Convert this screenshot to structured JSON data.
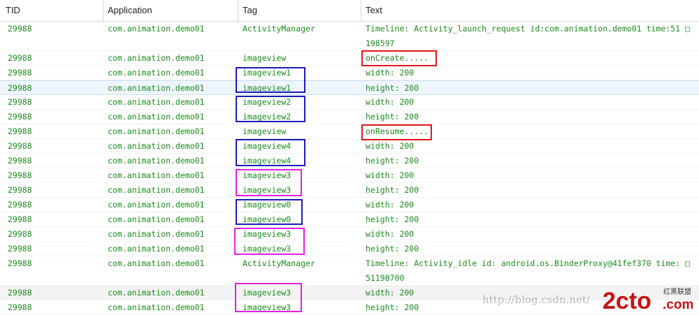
{
  "columns": {
    "tid": "TID",
    "application": "Application",
    "tag": "Tag",
    "text": "Text"
  },
  "rows": [
    {
      "tid": "29988",
      "app": "com.animation.demo01",
      "tag": "ActivityManager",
      "text": "Timeline: Activity_launch_request id:com.animation.demo01 time:51 □198597"
    },
    {
      "tid": "29988",
      "app": "com.animation.demo01",
      "tag": "imageview",
      "text": "onCreate....."
    },
    {
      "tid": "29988",
      "app": "com.animation.demo01",
      "tag": "imageview1",
      "text": "width: 200"
    },
    {
      "tid": "29988",
      "app": "com.animation.demo01",
      "tag": "imageview1",
      "text": "height: 200"
    },
    {
      "tid": "29988",
      "app": "com.animation.demo01",
      "tag": "imageview2",
      "text": "width: 200"
    },
    {
      "tid": "29988",
      "app": "com.animation.demo01",
      "tag": "imageview2",
      "text": "height: 200"
    },
    {
      "tid": "29988",
      "app": "com.animation.demo01",
      "tag": "imageview",
      "text": "onResume....."
    },
    {
      "tid": "29988",
      "app": "com.animation.demo01",
      "tag": "imageview4",
      "text": "width: 200"
    },
    {
      "tid": "29988",
      "app": "com.animation.demo01",
      "tag": "imageview4",
      "text": "height: 200"
    },
    {
      "tid": "29988",
      "app": "com.animation.demo01",
      "tag": "imageview3",
      "text": "width: 200"
    },
    {
      "tid": "29988",
      "app": "com.animation.demo01",
      "tag": "imageview3",
      "text": "height: 200"
    },
    {
      "tid": "29988",
      "app": "com.animation.demo01",
      "tag": "imageview0",
      "text": "width: 200"
    },
    {
      "tid": "29988",
      "app": "com.animation.demo01",
      "tag": "imageview0",
      "text": "height: 200"
    },
    {
      "tid": "29988",
      "app": "com.animation.demo01",
      "tag": "imageview3",
      "text": "width: 200"
    },
    {
      "tid": "29988",
      "app": "com.animation.demo01",
      "tag": "imageview3",
      "text": "height: 200"
    },
    {
      "tid": "29988",
      "app": "com.animation.demo01",
      "tag": "ActivityManager",
      "text": "Timeline: Activity_idle id: android.os.BinderProxy@41fef370 time: □51198700"
    },
    {
      "tid": "29988",
      "app": "com.animation.demo01",
      "tag": "imageview3",
      "text": "width: 200"
    },
    {
      "tid": "29988",
      "app": "com.animation.demo01",
      "tag": "imageview3",
      "text": "height: 200"
    }
  ],
  "watermark": {
    "url": "http://blog.csdn.net/",
    "logo_main": "2cto",
    "logo_suffix": ".com",
    "logo_cn": "红黑联盟"
  },
  "colors": {
    "log_text": "#1d8a1d",
    "annotation_red": "#e3151b",
    "annotation_blue": "#1a1ab8",
    "annotation_pink": "#e020e0"
  }
}
